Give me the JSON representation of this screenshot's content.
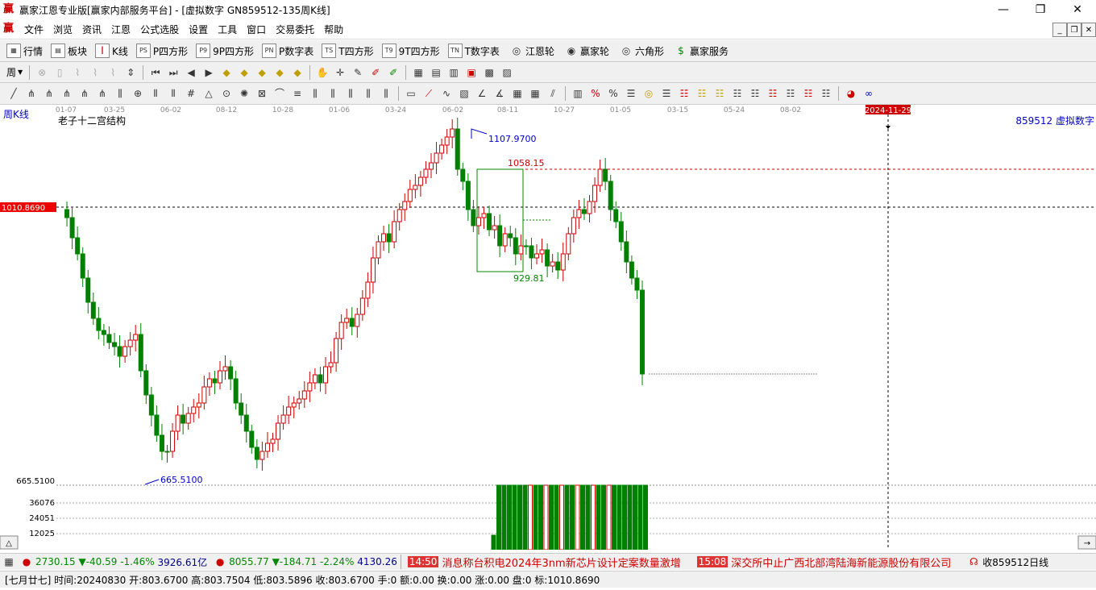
{
  "window": {
    "title": "赢家江恩专业版[赢家内部服务平台] - [虚拟数字  GN859512-135周K线]",
    "app_icon": "赢",
    "min": "—",
    "max": "❐",
    "close": "✕"
  },
  "menu": {
    "icon": "赢",
    "items": [
      "文件",
      "浏览",
      "资讯",
      "江恩",
      "公式选股",
      "设置",
      "工具",
      "窗口",
      "交易委托",
      "帮助"
    ]
  },
  "toolbar1": {
    "items": [
      "行情",
      "板块",
      "K线",
      "P四方形",
      "9P四方形",
      "P数字表",
      "T四方形",
      "9T四方形",
      "T数字表",
      "江恩轮",
      "赢家轮",
      "六角形",
      "赢家服务"
    ],
    "icon_labels": [
      "",
      "",
      "",
      "PS",
      "P9",
      "PN",
      "TS",
      "T9",
      "TN",
      "",
      "",
      "",
      "$"
    ]
  },
  "toolbar2": {
    "period_label": "周"
  },
  "chart": {
    "period_label": "周K线",
    "indicator_name": "老子十二宫结构",
    "symbol_label": "859512  虚拟数字",
    "current_price_tag": "1010.8690",
    "date_marker": "2024-11-29",
    "x_ticks": [
      "01-07",
      "03-25",
      "06-02",
      "08-12",
      "10-28",
      "01-06",
      "03-24",
      "06-02",
      "08-11",
      "10-27",
      "01-05",
      "03-15",
      "05-24",
      "08-02"
    ],
    "high_label": "1107.9700",
    "level_label": "1058.15",
    "box_low_label": "929.81",
    "low_label": "665.5100",
    "left_low_label": "665.5100",
    "vol_ticks": [
      "36076",
      "24051",
      "12025"
    ],
    "up_color": "#cc0000",
    "down_color": "#008000"
  },
  "chart_data": {
    "type": "candlestick",
    "title": "老子十二宫结构",
    "series_name": "859512  虚拟数字",
    "current_price": 1010.869,
    "high": 1107.97,
    "low": 665.51,
    "levels": [
      1058.15,
      929.81
    ]
  },
  "status1": {
    "idx1_value": "2730.15",
    "idx1_change": "▼-40.59",
    "idx1_pct": "-1.46%",
    "idx1_amount": "3926.61亿",
    "idx2_value": "8055.77",
    "idx2_change": "▼-184.71",
    "idx2_pct": "-2.24%",
    "idx2_amount": "4130.26",
    "news1_time": "14:50",
    "news1_text": "消息称台积电2024年3nm新芯片设计定案数量激增",
    "news2_time": "15:08",
    "news2_text": "深交所中止广西北部湾陆海新能源股份有限公司",
    "right_text": "收859512日线"
  },
  "status2": {
    "text": "[七月廿七] 时间:20240830 开:803.6700 高:803.7504 低:803.5896 收:803.6700 手:0 额:0.00 换:0.00 涨:0.00 盘:0 标:1010.8690"
  }
}
